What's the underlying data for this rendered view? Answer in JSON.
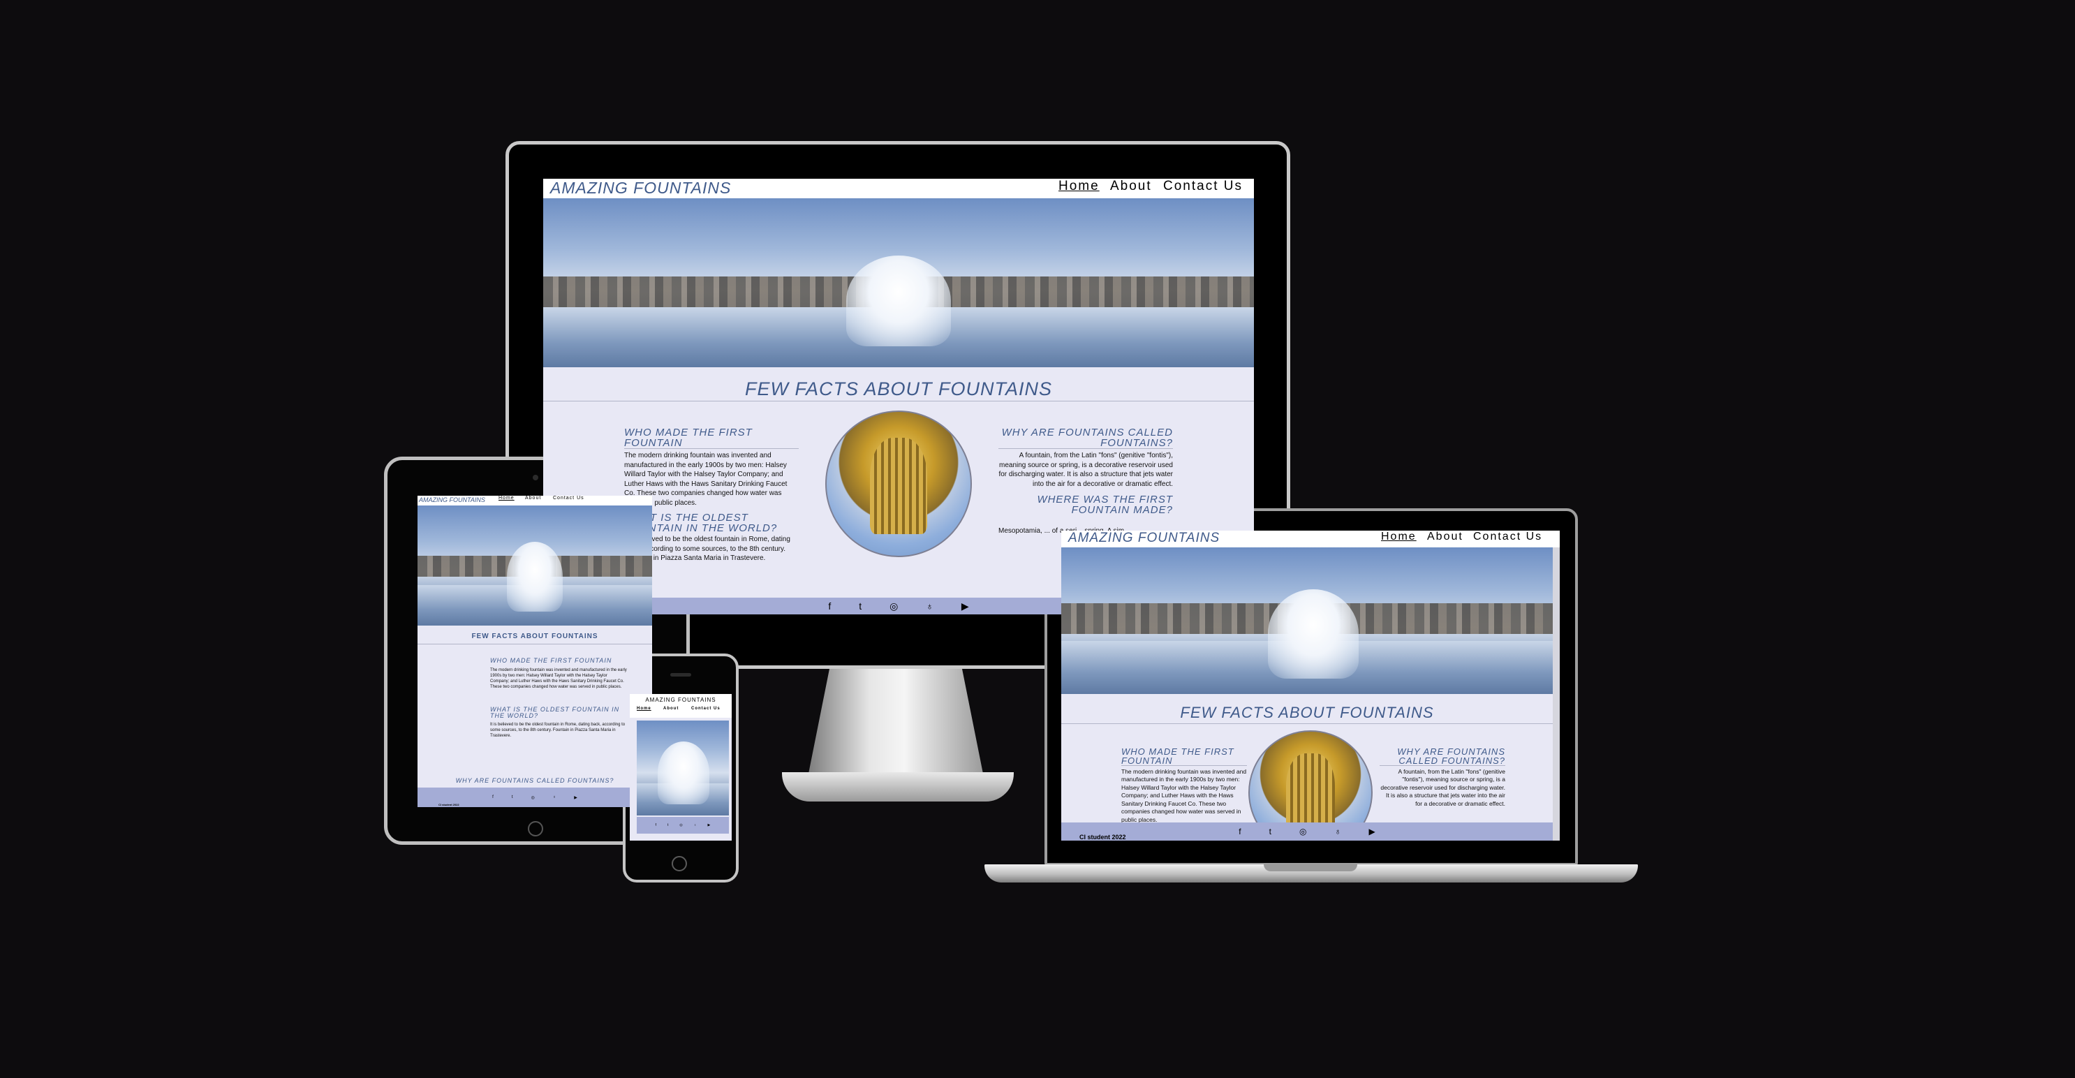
{
  "site": {
    "brand": "AMAZING FOUNTAINS",
    "nav": [
      {
        "label": "Home",
        "active": true
      },
      {
        "label": "About",
        "active": false
      },
      {
        "label": "Contact Us",
        "active": false
      }
    ],
    "section_title": "FEW FACTS ABOUT FOUNTAINS",
    "facts": {
      "first_heading": "WHO MADE THE FIRST FOUNTAIN",
      "first_body": "The modern drinking fountain was invented and manufactured in the early 1900s by two men: Halsey Willard Taylor with the Halsey Taylor Company; and Luther Haws with the Haws Sanitary Drinking Faucet Co. These two companies changed how water was served in public places.",
      "oldest_heading": "WHAT IS THE OLDEST FOUNTAIN IN THE WORLD?",
      "oldest_body": "It is believed to be the oldest fountain in Rome, dating back, according to some sources, to the 8th century. Fountain in Piazza Santa Maria in Trastevere.",
      "called_heading": "WHY ARE FOUNTAINS CALLED FOUNTAINS?",
      "called_body": "A fountain, from the Latin \"fons\" (genitive \"fontis\"), meaning source or spring, is a decorative reservoir used for discharging water. It is also a structure that jets water into the air for a decorative or dramatic effect.",
      "where_heading": "WHERE WAS THE FIRST FOUNTAIN MADE?",
      "where_body": "Mesopotamia, ... of a seri... spring. A sim..."
    },
    "footer_icons": [
      "facebook-icon",
      "twitter-icon",
      "instagram-icon",
      "github-icon",
      "youtube-icon"
    ],
    "footer_glyphs": [
      "f",
      "t",
      "◎",
      "♁",
      "▶"
    ],
    "copyright": "CI student 2022"
  },
  "colors": {
    "background": "#0d0c0e",
    "page": "#e8e8f5",
    "accent": "#3f5a8a",
    "footer": "#a4acd6"
  }
}
